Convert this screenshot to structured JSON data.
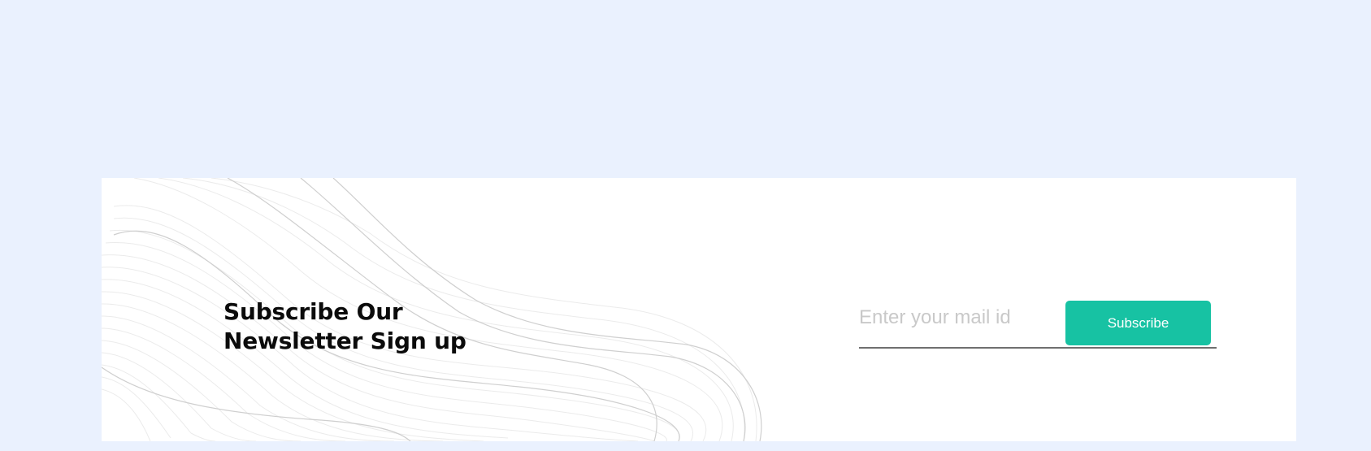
{
  "newsletter": {
    "title_line1": "Subscribe Our",
    "title_line2": "Newsletter Sign up",
    "email_placeholder": "Enter your mail id",
    "email_value": "",
    "subscribe_label": "Subscribe"
  },
  "colors": {
    "page_background": "#eaf1fe",
    "card_background": "#ffffff",
    "accent": "#17c2a3",
    "underline": "#6f6f6f",
    "title_text": "#0b0b0b"
  }
}
